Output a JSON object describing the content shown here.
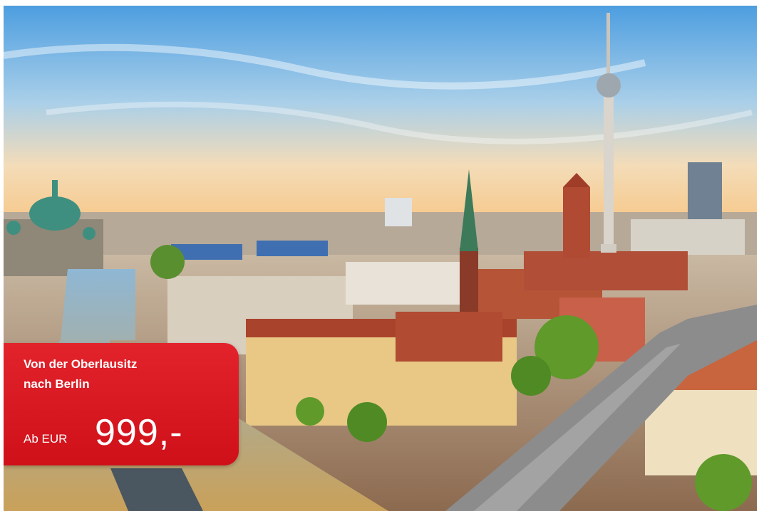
{
  "offer": {
    "headline_line1": "Von der Oberlausitz",
    "headline_line2": "nach Berlin",
    "price_prefix": "Ab EUR",
    "price": "999,-"
  },
  "colors": {
    "accent_red": "#e3232b",
    "text_on_accent": "#ffffff"
  },
  "image": {
    "subject": "berlin-skyline-photo"
  }
}
